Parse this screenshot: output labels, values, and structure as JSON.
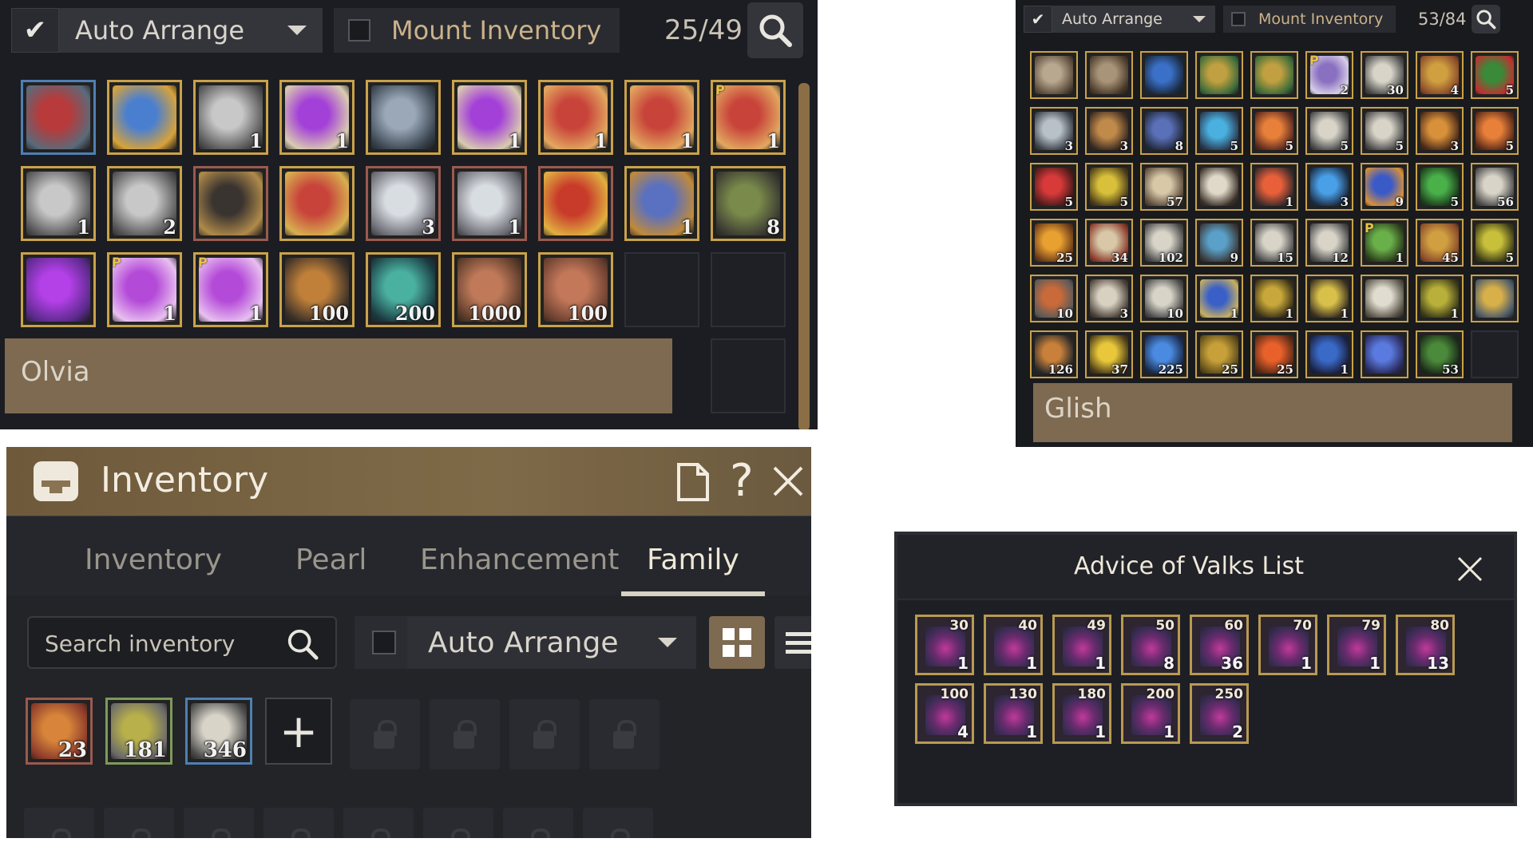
{
  "panel_a": {
    "auto_arrange_label": "Auto Arrange",
    "mount_inventory_label": "Mount Inventory",
    "counter": "25/49",
    "npc_name": "Olvia",
    "rows": [
      [
        {
          "icon": "armor-red-chest-icon",
          "qty": "",
          "border": "blue",
          "c1": "#b83a3a",
          "c2": "#5a6a7a"
        },
        {
          "icon": "blue-star-compass-icon",
          "qty": "",
          "border": "gold",
          "c1": "#4a7fd0",
          "c2": "#d8a23a"
        },
        {
          "icon": "white-coral-tree-icon",
          "qty": "1",
          "border": "gold",
          "c1": "#c8c8c8",
          "c2": "#555"
        },
        {
          "icon": "purple-orb-book-icon",
          "qty": "1",
          "border": "gold",
          "c1": "#a340d8",
          "c2": "#d9cbb0"
        },
        {
          "icon": "silver-necklace-icon",
          "qty": "",
          "border": "gold",
          "c1": "#9aa8b8",
          "c2": "#3a4550"
        },
        {
          "icon": "purple-orb-book-icon",
          "qty": "1",
          "border": "gold",
          "c1": "#a340d8",
          "c2": "#d9cbb0"
        },
        {
          "icon": "red-gift-box-icon",
          "qty": "1",
          "border": "gold",
          "c1": "#c8443a",
          "c2": "#e2a860"
        },
        {
          "icon": "red-gift-box-icon",
          "qty": "1",
          "border": "gold",
          "c1": "#c8443a",
          "c2": "#e2a860"
        },
        {
          "icon": "red-gift-box-icon",
          "qty": "1",
          "border": "gold",
          "c1": "#c8443a",
          "c2": "#e2a860",
          "p": "P"
        }
      ],
      [
        {
          "icon": "white-coral-tree-icon",
          "qty": "1",
          "border": "gold",
          "c1": "#c8c8c8",
          "c2": "#555"
        },
        {
          "icon": "white-coral-tree-icon",
          "qty": "2",
          "border": "gold",
          "c1": "#c8c8c8",
          "c2": "#555"
        },
        {
          "icon": "dark-treasure-chest-icon",
          "qty": "",
          "border": "red",
          "c1": "#3a3430",
          "c2": "#b08a4a"
        },
        {
          "icon": "jeweled-treasure-chest-icon",
          "qty": "",
          "border": "gold",
          "c1": "#c8443a",
          "c2": "#d8b050"
        },
        {
          "icon": "silver-chest-icon",
          "qty": "3",
          "border": "red",
          "c1": "#d8dde2",
          "c2": "#6a6a72"
        },
        {
          "icon": "silver-chest-icon",
          "qty": "1",
          "border": "red",
          "c1": "#d8dde2",
          "c2": "#6a6a72"
        },
        {
          "icon": "golden-red-chest-icon",
          "qty": "",
          "border": "red",
          "c1": "#c83a2a",
          "c2": "#e0b040"
        },
        {
          "icon": "gem-chest-icon",
          "qty": "1",
          "border": "gold",
          "c1": "#5a70c0",
          "c2": "#c08a3a"
        },
        {
          "icon": "green-cauldron-icon",
          "qty": "8",
          "border": "gold",
          "c1": "#7a8a4a",
          "c2": "#3a3a32"
        }
      ],
      [
        {
          "icon": "purple-scroll-icon",
          "qty": "",
          "border": "gold",
          "c1": "#b440e8",
          "c2": "#5a2a8a"
        },
        {
          "icon": "purple-chest-icon",
          "qty": "1",
          "border": "gold",
          "c1": "#b44ad8",
          "c2": "#e8c0f0",
          "p": "P"
        },
        {
          "icon": "purple-chest-icon",
          "qty": "1",
          "border": "gold",
          "c1": "#b44ad8",
          "c2": "#e8c0f0",
          "p": "P"
        },
        {
          "icon": "elixir-bottle-icon",
          "qty": "100",
          "border": "gold",
          "c1": "#c0803a",
          "c2": "#3a3028"
        },
        {
          "icon": "green-orb-icon",
          "qty": "200",
          "border": "gold",
          "c1": "#4ab0a0",
          "c2": "#1a3a40"
        },
        {
          "icon": "clay-jar-icon",
          "qty": "1000",
          "border": "gold",
          "c1": "#c07a5a",
          "c2": "#5a3a2a"
        },
        {
          "icon": "bread-stone-icon",
          "qty": "100",
          "border": "gold",
          "c1": "#c4785a",
          "c2": "#6a4030"
        },
        {
          "icon": "",
          "qty": "",
          "border": "empty"
        },
        {
          "icon": "",
          "qty": "",
          "border": "empty"
        }
      ]
    ]
  },
  "panel_b": {
    "auto_arrange_label": "Auto Arrange",
    "mount_inventory_label": "Mount Inventory",
    "counter": "53/84",
    "npc_name": "Glish",
    "rows": [
      [
        {
          "icon": "cloth-shirt-icon",
          "qty": "",
          "c1": "#b8a890",
          "c2": "#5a4a3a"
        },
        {
          "icon": "cloth-shirt-icon",
          "qty": "",
          "c1": "#a89478",
          "c2": "#4a3a2a"
        },
        {
          "icon": "blue-necklace-icon",
          "qty": "",
          "c1": "#3a70c8",
          "c2": "#1a2a40"
        },
        {
          "icon": "green-gold-ring-icon",
          "qty": "",
          "c1": "#c0a040",
          "c2": "#3a6a3a"
        },
        {
          "icon": "green-gold-ring-icon",
          "qty": "",
          "c1": "#c0a040",
          "c2": "#3a6a3a"
        },
        {
          "icon": "purple-scroll-icon",
          "qty": "2",
          "c1": "#8a70c0",
          "c2": "#d8d0e8",
          "p": "P"
        },
        {
          "icon": "map-scroll-icon",
          "qty": "30",
          "c1": "#d8d4c8",
          "c2": "#4a4a4a"
        },
        {
          "icon": "food-box-icon",
          "qty": "4",
          "c1": "#d0a040",
          "c2": "#8a4a2a"
        },
        {
          "icon": "christmas-tree-icon",
          "qty": "5",
          "c1": "#3a8a3a",
          "c2": "#c03030"
        }
      ],
      [
        {
          "icon": "silver-flask-icon",
          "qty": "3",
          "c1": "#b8c0c8",
          "c2": "#3a4048"
        },
        {
          "icon": "bronze-flask-icon",
          "qty": "3",
          "c1": "#c08a4a",
          "c2": "#3a2a20"
        },
        {
          "icon": "v-emblem-icon",
          "qty": "8",
          "c1": "#5a70b8",
          "c2": "#20283a"
        },
        {
          "icon": "blue-cocktail-icon",
          "qty": "5",
          "c1": "#4ab0e0",
          "c2": "#2a3a50"
        },
        {
          "icon": "orange-cocktail-icon",
          "qty": "5",
          "c1": "#e8803a",
          "c2": "#5a2a20"
        },
        {
          "icon": "map-scroll-icon",
          "qty": "5",
          "c1": "#d8d4c8",
          "c2": "#4a4a4a"
        },
        {
          "icon": "map-scroll-icon",
          "qty": "5",
          "c1": "#d8d4c8",
          "c2": "#4a4a4a"
        },
        {
          "icon": "stew-bowl-icon",
          "qty": "3",
          "c1": "#d8903a",
          "c2": "#4a2a18"
        },
        {
          "icon": "orange-potion-icon",
          "qty": "5",
          "c1": "#e8803a",
          "c2": "#5a2a18"
        }
      ],
      [
        {
          "icon": "red-potion-icon",
          "qty": "5",
          "c1": "#d83a3a",
          "c2": "#4a1a1a"
        },
        {
          "icon": "yellow-potion-icon",
          "qty": "5",
          "c1": "#d8c03a",
          "c2": "#4a3a18"
        },
        {
          "icon": "letter-icon",
          "qty": "57",
          "c1": "#d8c8a8",
          "c2": "#5a4a3a"
        },
        {
          "icon": "claws-icon",
          "qty": "",
          "c1": "#e0d8c8",
          "c2": "#3a3028"
        },
        {
          "icon": "fire-bottle-icon",
          "qty": "1",
          "c1": "#e8603a",
          "c2": "#3a2a2a"
        },
        {
          "icon": "blue-vial-icon",
          "qty": "3",
          "c1": "#4aa0e8",
          "c2": "#1a2a40"
        },
        {
          "icon": "blue-bomb-icon",
          "qty": "9",
          "c1": "#3a5ac8",
          "c2": "#d8903a"
        },
        {
          "icon": "green-potion-icon",
          "qty": "5",
          "c1": "#4ab04a",
          "c2": "#1a3a1a"
        },
        {
          "icon": "map-scroll-icon",
          "qty": "56",
          "c1": "#d8d4c8",
          "c2": "#4a4a4a"
        }
      ],
      [
        {
          "icon": "gold-ticket-icon",
          "qty": "25",
          "c1": "#e8a030",
          "c2": "#6a3a1a"
        },
        {
          "icon": "sealed-letter-icon",
          "qty": "34",
          "c1": "#d8c8a8",
          "c2": "#8a3a2a"
        },
        {
          "icon": "map-scroll-icon",
          "qty": "102",
          "c1": "#d8d4c8",
          "c2": "#4a4a4a"
        },
        {
          "icon": "blue-frame-scroll-icon",
          "qty": "9",
          "c1": "#5aa0c8",
          "c2": "#3a3a3a"
        },
        {
          "icon": "map-scroll-icon",
          "qty": "15",
          "c1": "#d8d4c8",
          "c2": "#4a4a4a"
        },
        {
          "icon": "map-scroll-icon",
          "qty": "12",
          "c1": "#d8d4c8",
          "c2": "#4a4a4a"
        },
        {
          "icon": "green-flower-potion-icon",
          "qty": "1",
          "c1": "#6ab04a",
          "c2": "#2a3a1a",
          "p": "P"
        },
        {
          "icon": "food-box-icon",
          "qty": "45",
          "c1": "#d0a040",
          "c2": "#8a4a2a"
        },
        {
          "icon": "yellow-flask-icon",
          "qty": "5",
          "c1": "#c8c03a",
          "c2": "#3a3a18"
        }
      ],
      [
        {
          "icon": "tea-cup-icon",
          "qty": "10",
          "c1": "#c86a3a",
          "c2": "#5a5a5a"
        },
        {
          "icon": "map-parchment-icon",
          "qty": "3",
          "c1": "#d8d0c0",
          "c2": "#4a4038"
        },
        {
          "icon": "map-scroll-icon",
          "qty": "10",
          "c1": "#d8d4c8",
          "c2": "#4a4a4a"
        },
        {
          "icon": "blue-card-icon",
          "qty": "1",
          "c1": "#3a60c8",
          "c2": "#c8b060"
        },
        {
          "icon": "gold-card-icon",
          "qty": "1",
          "c1": "#c8a83a",
          "c2": "#3a3018"
        },
        {
          "icon": "gold-slate-icon",
          "qty": "1",
          "c1": "#d8c04a",
          "c2": "#3a3020"
        },
        {
          "icon": "paper-note-icon",
          "qty": "",
          "c1": "#e0dcd0",
          "c2": "#5a5448"
        },
        {
          "icon": "gold-card-icon",
          "qty": "1",
          "c1": "#b8b03a",
          "c2": "#3a3a18"
        },
        {
          "icon": "gold-medallion-icon",
          "qty": "",
          "c1": "#d8b04a",
          "c2": "#4a5a6a"
        }
      ],
      [
        {
          "icon": "cannon-icon",
          "qty": "126",
          "c1": "#c8803a",
          "c2": "#2a2a2a"
        },
        {
          "icon": "yellow-oil-bottle-icon",
          "qty": "37",
          "c1": "#e8c83a",
          "c2": "#4a3a18"
        },
        {
          "icon": "blue-shell-icon",
          "qty": "225",
          "c1": "#4a8ae0",
          "c2": "#1a2a4a"
        },
        {
          "icon": "golden-fruit-icon",
          "qty": "25",
          "c1": "#c8a03a",
          "c2": "#5a4a18"
        },
        {
          "icon": "fire-leaf-icon",
          "qty": "25",
          "c1": "#e8602a",
          "c2": "#5a2a18"
        },
        {
          "icon": "blue-horn-icon",
          "qty": "1",
          "c1": "#3a6ac8",
          "c2": "#1a2040"
        },
        {
          "icon": "blue-dragon-icon",
          "qty": "",
          "c1": "#5a7ae0",
          "c2": "#2a2a5a"
        },
        {
          "icon": "fern-herb-icon",
          "qty": "53",
          "c1": "#4a8a3a",
          "c2": "#1a2a18"
        },
        {
          "icon": "",
          "qty": "",
          "empty": true
        }
      ]
    ]
  },
  "panel_c": {
    "title": "Inventory",
    "tabs": [
      "Inventory",
      "Pearl",
      "Enhancement",
      "Family"
    ],
    "active_tab": "Family",
    "search_placeholder": "Search inventory",
    "auto_arrange_label": "Auto Arrange",
    "items": [
      {
        "icon": "food-platter-icon",
        "qty": "23",
        "border": "red",
        "c1": "#d8843a",
        "c2": "#8a3a2a"
      },
      {
        "icon": "herb-bowl-icon",
        "qty": "181",
        "border": "green",
        "c1": "#b8b04a",
        "c2": "#6a6a6a"
      },
      {
        "icon": "map-scroll-icon",
        "qty": "346",
        "border": "blue",
        "c1": "#d8d4c8",
        "c2": "#4a4a4a"
      }
    ],
    "add_label": "+"
  },
  "panel_d": {
    "title": "Advice of Valks List",
    "items": [
      {
        "level": "30",
        "count": "1"
      },
      {
        "level": "40",
        "count": "1"
      },
      {
        "level": "49",
        "count": "1"
      },
      {
        "level": "50",
        "count": "8"
      },
      {
        "level": "60",
        "count": "36"
      },
      {
        "level": "70",
        "count": "1"
      },
      {
        "level": "79",
        "count": "1"
      },
      {
        "level": "80",
        "count": "13"
      },
      {
        "level": "100",
        "count": "4"
      },
      {
        "level": "130",
        "count": "1"
      },
      {
        "level": "180",
        "count": "1"
      },
      {
        "level": "200",
        "count": "1"
      },
      {
        "level": "250",
        "count": "2"
      }
    ]
  }
}
